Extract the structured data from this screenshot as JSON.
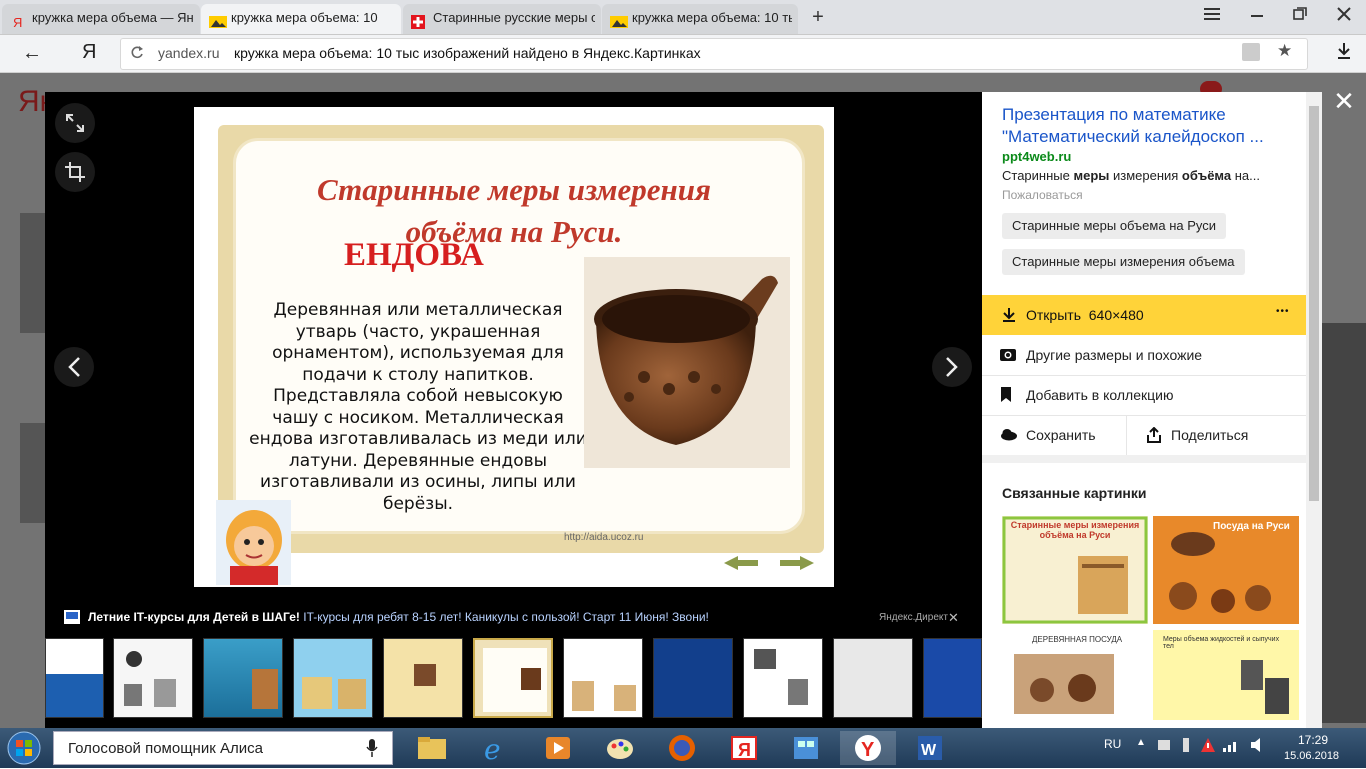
{
  "browser": {
    "tabs": [
      {
        "label": "кружка мера объема — Ян",
        "icon": "yandex-icon",
        "active": false
      },
      {
        "label": "кружка мера объема: 10",
        "icon": "yandex-images-icon",
        "active": true
      },
      {
        "label": "Старинные русские меры о",
        "icon": "swiss-flag-icon",
        "active": false
      },
      {
        "label": "кружка мера объема: 10 ты",
        "icon": "yandex-images-icon",
        "active": false
      }
    ],
    "new_tab": "+",
    "back_glyph": "←",
    "ya_glyph": "Я",
    "url_domain": "yandex.ru",
    "page_title": "кружка мера объема: 10 тыс изображений найдено в Яндекс.Картинках"
  },
  "viewer": {
    "slide": {
      "title_line1": "Старинные меры измерения",
      "title_line2": "объёма  на Руси.",
      "heading": "ЕНДОВА",
      "body": "Деревянная или металлическая утварь (часто, украшенная орнаментом), используемая для подачи к столу напитков. Представляла собой невысокую чашу с носиком. Металлическая ендова изготавливалась из меди или латуни. Деревянные ендовы изготавливали из осины, липы или берёзы.",
      "caption": "http://aida.ucoz.ru"
    },
    "ad": {
      "bold": "Летние IT-курсы для Детей в ШАГе!",
      "text": "IT-курсы для ребят 8-15 лет! Каникулы с пользой! Старт 11 Июня! Звони!",
      "source": "Яндекс.Директ"
    },
    "close_glyph": "✕"
  },
  "panel": {
    "title": "Презентация по математике \"Математический калейдоскоп ...",
    "domain": "ppt4web.ru",
    "desc_parts": [
      "Старинные ",
      "меры",
      " измерения ",
      "объёма",
      " на..."
    ],
    "complain": "Пожаловаться",
    "chips": [
      "Старинные меры объема на Руси",
      "Старинные меры измерения объема"
    ],
    "open_label": "Открыть",
    "open_size": "640×480",
    "more_glyph": "•••",
    "similar_label": "Другие размеры и похожие",
    "collection_label": "Добавить в коллекцию",
    "save_label": "Сохранить",
    "share_label": "Поделиться",
    "related_title": "Связанные картинки",
    "related_captions": [
      "Старинные меры измерения объёма на Руси",
      "Посуда на Руси",
      "ДЕРЕВЯННАЯ ПОСУДА",
      "Меры объема жидкостей и сыпучих тел"
    ]
  },
  "taskbar": {
    "alice_label": "Голосовой помощник Алиса",
    "lang": "RU",
    "time": "17:29",
    "date": "15.06.2018"
  },
  "colors": {
    "accent": "#ffd339",
    "link": "#1a55c9",
    "domain": "#0b8a1a",
    "slide_red": "#c0392b"
  }
}
